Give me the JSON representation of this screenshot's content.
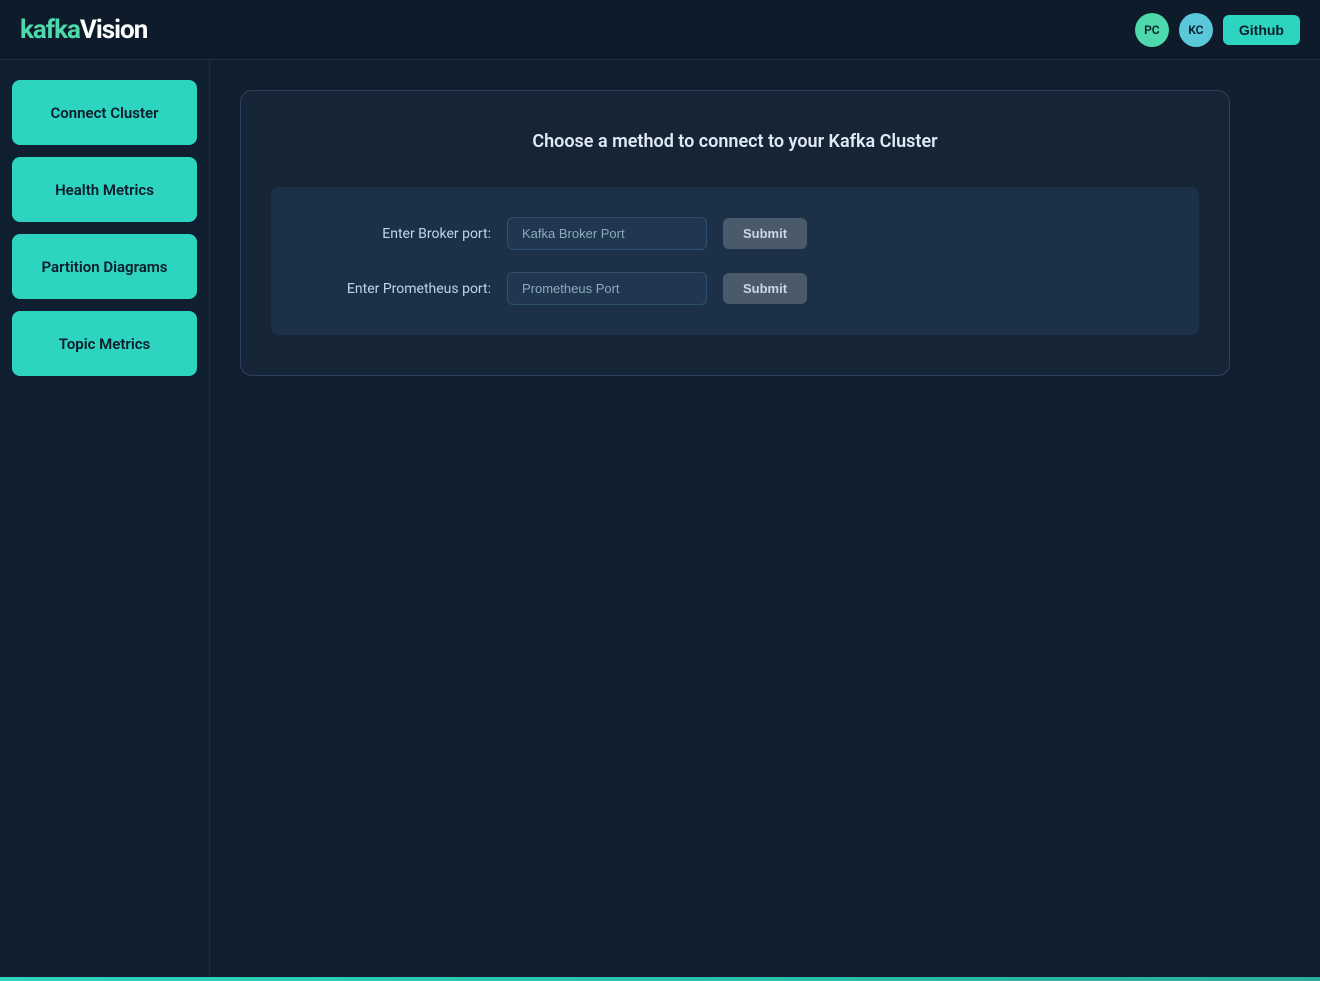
{
  "header": {
    "logo_kafka": "kafka",
    "logo_vision": "Vision",
    "github_label": "Github",
    "avatar_pc": "PC",
    "avatar_kc": "KC"
  },
  "sidebar": {
    "items": [
      {
        "id": "connect-cluster",
        "label": "Connect Cluster"
      },
      {
        "id": "health-metrics",
        "label": "Health Metrics"
      },
      {
        "id": "partition-diagrams",
        "label": "Partition Diagrams"
      },
      {
        "id": "topic-metrics",
        "label": "Topic Metrics"
      }
    ]
  },
  "main": {
    "connection_card": {
      "title": "Choose a method to connect to your Kafka Cluster",
      "broker_label": "Enter Broker port:",
      "broker_placeholder": "Kafka Broker Port",
      "broker_submit": "Submit",
      "prometheus_label": "Enter Prometheus port:",
      "prometheus_placeholder": "Prometheus Port",
      "prometheus_submit": "Submit"
    }
  }
}
